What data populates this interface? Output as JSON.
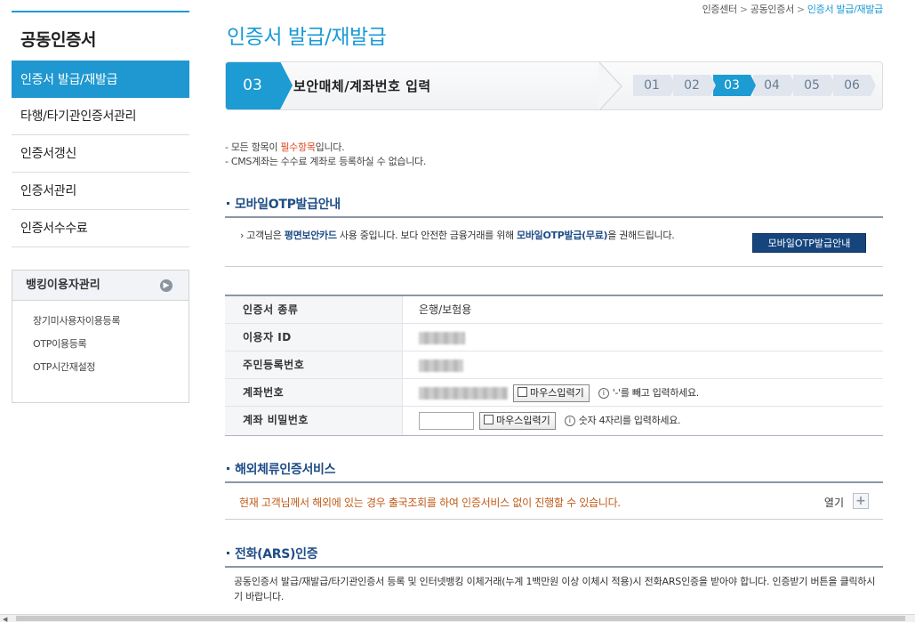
{
  "sidebar": {
    "title": "공동인증서",
    "menu": [
      {
        "label": "인증서 발급/재발급",
        "active": true
      },
      {
        "label": "타행/타기관인증서관리",
        "active": false
      },
      {
        "label": "인증서갱신",
        "active": false
      },
      {
        "label": "인증서관리",
        "active": false
      },
      {
        "label": "인증서수수료",
        "active": false
      }
    ],
    "banking": {
      "title": "뱅킹이용자관리",
      "links": [
        "장기미사용자이용등록",
        "OTP이용등록",
        "OTP시간재설정"
      ]
    }
  },
  "breadcrumb": [
    "인증센터",
    "공동인증서",
    "인증서 발급/재발급"
  ],
  "page_title": "인증서 발급/재발급",
  "stepbar": {
    "current_num": "03",
    "current_label": "보안매체/계좌번호 입력",
    "steps": [
      "01",
      "02",
      "03",
      "04",
      "05",
      "06"
    ],
    "current_index": 2
  },
  "notes": {
    "line1_pre": "- 모든 항목이 ",
    "line1_req": "필수항목",
    "line1_post": "입니다.",
    "line2": "- CMS계좌는 수수료 계좌로 등록하실 수 없습니다."
  },
  "otp_section": {
    "heading": "모바일OTP발급안내",
    "text_1": "고객님은 ",
    "bold_1": "평면보안카드",
    "text_2": " 사용 중입니다. 보다 안전한 금융거래를 위해 ",
    "bold_2": "모바일OTP발급(무료)",
    "text_3": "을 권해드립니다.",
    "button": "모바일OTP발급안내"
  },
  "form": {
    "rows": [
      {
        "label": "인증서 종류",
        "value": "은행/보험용"
      },
      {
        "label": "이용자 ID"
      },
      {
        "label": "주민등록번호"
      },
      {
        "label": "계좌번호",
        "mouse_btn": "마우스입력기",
        "hint": "'-'를 빼고 입력하세요."
      },
      {
        "label": "계좌 비밀번호",
        "mouse_btn": "마우스입력기",
        "hint": "숫자 4자리를 입력하세요."
      }
    ],
    "info_icon": "i"
  },
  "overseas": {
    "heading": "해외체류인증서비스",
    "text": "현재 고객님께서 해외에 있는 경우 출국조회를 하여 인증서비스 없이 진행할 수 있습니다.",
    "open_label": "열기",
    "open_symbol": "+"
  },
  "ars": {
    "heading": "전화(ARS)인증",
    "text": "공동인증서 발급/재발급/타기관인증서 등록 및 인터넷뱅킹 이체거래(누계 1백만원 이상 이체시 적용)시 전화ARS인증을 받아야 합니다. 인증받기 버튼을 클릭하시기 바랍니다."
  },
  "colors": {
    "accent": "#1a9ad6",
    "navy": "#1f4d86",
    "required": "#e0451b",
    "notice": "#c05a16"
  }
}
